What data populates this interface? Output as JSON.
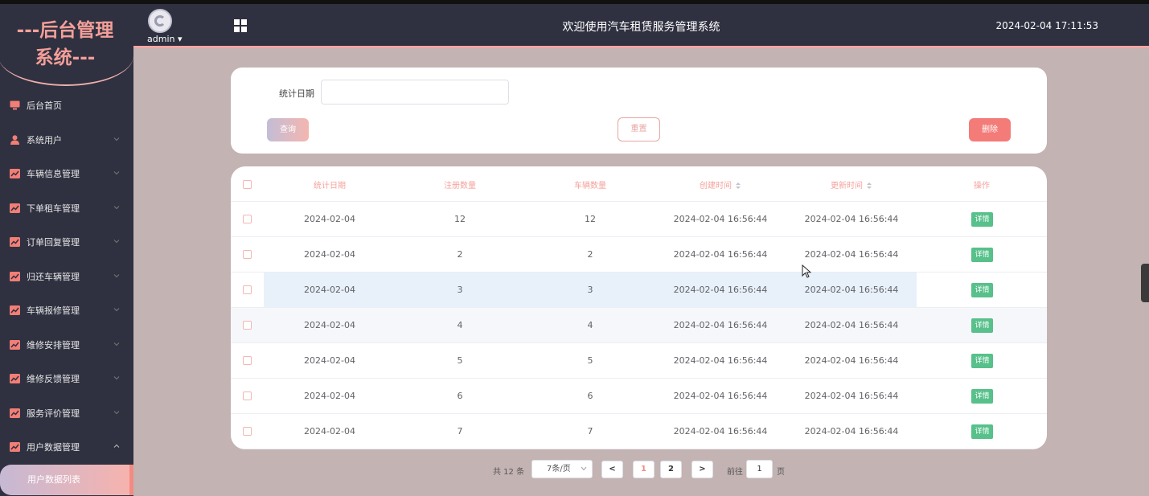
{
  "brand": {
    "line1": "---后台管理",
    "line2": "系统---"
  },
  "header": {
    "username": "admin ▾",
    "title": "欢迎使用汽车租赁服务管理系统",
    "datetime": "2024-02-04 17:11:53"
  },
  "menu": [
    {
      "label": "后台首页",
      "icon": "monitor-icon",
      "arrow": ""
    },
    {
      "label": "系统用户",
      "icon": "user-icon",
      "arrow": "down"
    },
    {
      "label": "车辆信息管理",
      "icon": "chart-icon",
      "arrow": "down"
    },
    {
      "label": "下单租车管理",
      "icon": "chart-icon",
      "arrow": "down"
    },
    {
      "label": "订单回复管理",
      "icon": "chart-icon",
      "arrow": "down"
    },
    {
      "label": "归还车辆管理",
      "icon": "chart-icon",
      "arrow": "down"
    },
    {
      "label": "车辆报修管理",
      "icon": "chart-icon",
      "arrow": "down"
    },
    {
      "label": "维修安排管理",
      "icon": "chart-icon",
      "arrow": "down"
    },
    {
      "label": "维修反馈管理",
      "icon": "chart-icon",
      "arrow": "down"
    },
    {
      "label": "服务评价管理",
      "icon": "chart-icon",
      "arrow": "down"
    },
    {
      "label": "用户数据管理",
      "icon": "chart-icon",
      "arrow": "up"
    }
  ],
  "submenu": {
    "active_label": "用户数据列表"
  },
  "search": {
    "label": "统计日期",
    "input_value": "",
    "query_label": "查询",
    "reset_label": "重置",
    "delete_label": "删除"
  },
  "table": {
    "headers": [
      "统计日期",
      "注册数量",
      "车辆数量",
      "创建时间",
      "更新时间",
      "操作"
    ],
    "sortable": [
      "创建时间",
      "更新时间"
    ],
    "detail_label": "详情",
    "rows": [
      [
        "2024-02-04",
        "12",
        "12",
        "2024-02-04 16:56:44",
        "2024-02-04 16:56:44"
      ],
      [
        "2024-02-04",
        "2",
        "2",
        "2024-02-04 16:56:44",
        "2024-02-04 16:56:44"
      ],
      [
        "2024-02-04",
        "3",
        "3",
        "2024-02-04 16:56:44",
        "2024-02-04 16:56:44"
      ],
      [
        "2024-02-04",
        "4",
        "4",
        "2024-02-04 16:56:44",
        "2024-02-04 16:56:44"
      ],
      [
        "2024-02-04",
        "5",
        "5",
        "2024-02-04 16:56:44",
        "2024-02-04 16:56:44"
      ],
      [
        "2024-02-04",
        "6",
        "6",
        "2024-02-04 16:56:44",
        "2024-02-04 16:56:44"
      ],
      [
        "2024-02-04",
        "7",
        "7",
        "2024-02-04 16:56:44",
        "2024-02-04 16:56:44"
      ]
    ],
    "hovered_row": 2
  },
  "pagination": {
    "total": "共 12 条",
    "page_size": "7条/页",
    "prev": "<",
    "pages": [
      "1",
      "2"
    ],
    "current_page": "1",
    "next": ">",
    "goto_label": "前往",
    "goto_value": "1",
    "goto_unit": "页"
  },
  "colors": {
    "sidebar_bg": "#2f3140",
    "content_bg": "#c4b3b3",
    "accent_pink": "#f4a29c",
    "delete_red": "#f37b78",
    "detail_green": "#57c08b"
  }
}
